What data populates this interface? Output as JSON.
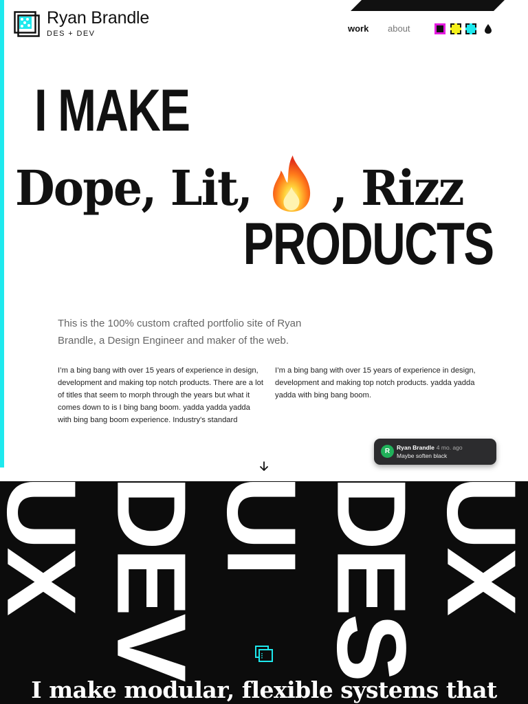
{
  "brand": {
    "name": "Ryan Brandle",
    "tagline": "DES + DEV"
  },
  "nav": {
    "items": [
      {
        "label": "work",
        "active": true
      },
      {
        "label": "about",
        "active": false
      }
    ]
  },
  "theme_swatches": [
    {
      "name": "black",
      "color": "#111111",
      "selected": true
    },
    {
      "name": "yellow",
      "color": "#f4f01b",
      "selected": false
    },
    {
      "name": "cyan",
      "color": "#1ee9ee",
      "selected": false
    }
  ],
  "colors": {
    "accent": "#1ee9ee",
    "highlight": "#e51be0",
    "dark": "#0c0c0c",
    "comment_avatar": "#20b15a"
  },
  "hero": {
    "line1": "I MAKE",
    "line2_before": "Dope, Lit,",
    "line2_after": ", Rizz",
    "line3": "PRODUCTS",
    "emoji_icon": "fire-icon"
  },
  "intro": "This is the 100% custom crafted portfolio site of Ryan Brandle, a Design Engineer and maker of the web.",
  "columns": [
    "I’m a bing bang with over 15 years of experience in design, development and making top notch products. There are a lot of titles that seem to morph through the years but what it comes down to is I bing bang boom. yadda yadda yadda with bing bang boom experience. Industry's standard",
    "I’m a bing bang with over 15 years of experience in design, development and making top notch products. yadda yadda yadda with bing bang boom."
  ],
  "comment": {
    "avatar_initial": "R",
    "author": "Ryan Brandle",
    "time": "4 mo. ago",
    "text": "Maybe soften black"
  },
  "disciplines": [
    "UX",
    "DEV",
    "UI",
    "DES",
    "UX"
  ],
  "tagline": "I make modular, flexible systems that"
}
